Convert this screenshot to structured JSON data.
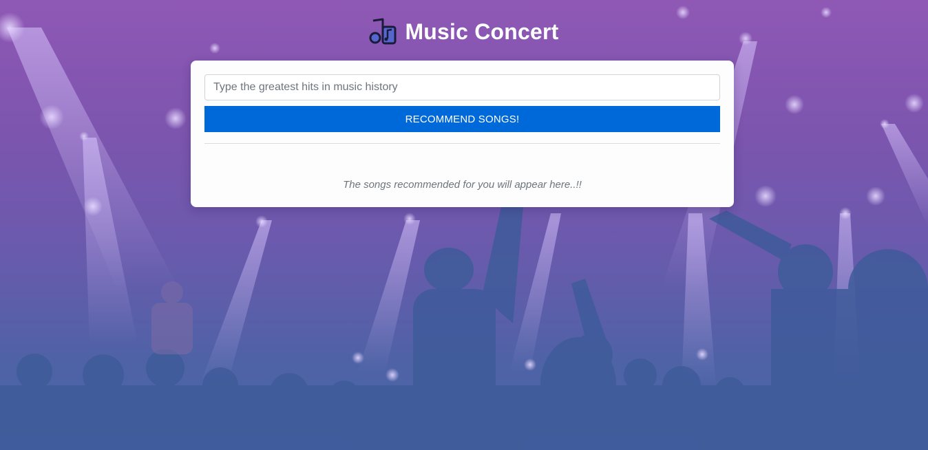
{
  "header": {
    "title": "Music Concert",
    "icon": "music-notes-icon"
  },
  "search": {
    "placeholder": "Type the greatest hits in music history",
    "value": ""
  },
  "actions": {
    "recommend_label": "RECOMMEND SONGS!"
  },
  "results": {
    "empty_message": "The songs recommended for you will appear here..!!"
  },
  "colors": {
    "button": "#0069d9",
    "card_background": "#fdfdfd",
    "background_tint": "#7b57ad",
    "title": "#ffffff"
  }
}
